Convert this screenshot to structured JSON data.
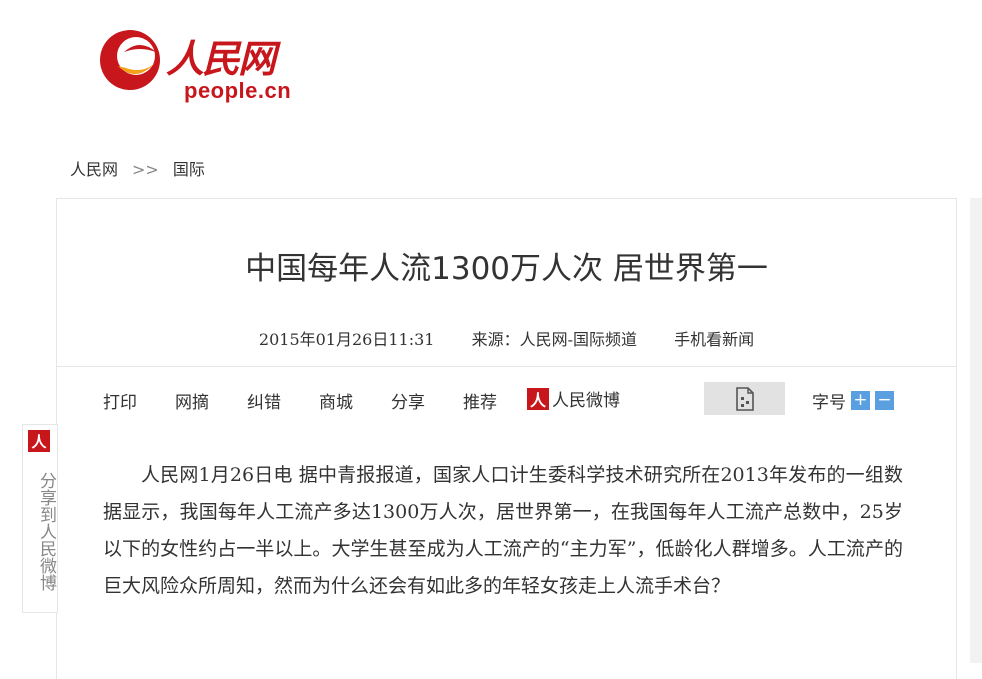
{
  "logo": {
    "cn": "人民网",
    "en": "people.cn"
  },
  "breadcrumb": {
    "home": "人民网",
    "separator": ">>",
    "section": "国际"
  },
  "article": {
    "title": "中国每年人流1300万人次 居世界第一",
    "datetime": "2015年01月26日11:31",
    "source": "来源：人民网-国际频道",
    "mobile": "手机看新闻",
    "body": "人民网1月26日电 据中青报报道，国家人口计生委科学技术研究所在2013年发布的一组数据显示，我国每年人工流产多达1300万人次，居世界第一，在我国每年人工流产总数中，25岁以下的女性约占一半以上。大学生甚至成为人工流产的“主力军”，低龄化人群增多。人工流产的巨大风险众所周知，然而为什么还会有如此多的年轻女孩走上人流手术台？"
  },
  "toolbar": {
    "print": "打印",
    "digest": "网摘",
    "correct": "纠错",
    "mall": "商城",
    "share": "分享",
    "recommend": "推荐",
    "weibo": "人民微博",
    "fontsize": "字号",
    "plus": "+",
    "minus": "−"
  },
  "share_sidebar": {
    "text": "分享到人民微博"
  },
  "colors": {
    "brand": "#c8161d",
    "accent": "#5aa0e0"
  },
  "icons": {
    "weibo": "people-weibo-icon",
    "qr": "qr-code-icon"
  }
}
